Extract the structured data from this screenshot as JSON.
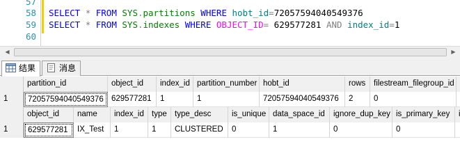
{
  "editor": {
    "lines": [
      {
        "num": "57",
        "tokens": []
      },
      {
        "num": "58",
        "tokens": [
          {
            "t": "SELECT",
            "c": "kw"
          },
          {
            "t": " ",
            "c": "pl"
          },
          {
            "t": "*",
            "c": "op"
          },
          {
            "t": " ",
            "c": "pl"
          },
          {
            "t": "FROM",
            "c": "kw"
          },
          {
            "t": " ",
            "c": "pl"
          },
          {
            "t": "SYS",
            "c": "sys"
          },
          {
            "t": ".",
            "c": "op"
          },
          {
            "t": "partitions",
            "c": "sys"
          },
          {
            "t": " ",
            "c": "pl"
          },
          {
            "t": "WHERE",
            "c": "kw"
          },
          {
            "t": " ",
            "c": "pl"
          },
          {
            "t": "hobt_id",
            "c": "id"
          },
          {
            "t": "=",
            "c": "op"
          },
          {
            "t": "72057594040549376",
            "c": "pl"
          }
        ]
      },
      {
        "num": "59",
        "tokens": [
          {
            "t": "SELECT",
            "c": "kw"
          },
          {
            "t": " ",
            "c": "pl"
          },
          {
            "t": "*",
            "c": "op"
          },
          {
            "t": " ",
            "c": "pl"
          },
          {
            "t": "FROM",
            "c": "kw"
          },
          {
            "t": " ",
            "c": "pl"
          },
          {
            "t": "SYS",
            "c": "sys"
          },
          {
            "t": ".",
            "c": "op"
          },
          {
            "t": "indexes",
            "c": "sys"
          },
          {
            "t": " ",
            "c": "pl"
          },
          {
            "t": "WHERE",
            "c": "kw"
          },
          {
            "t": " ",
            "c": "pl"
          },
          {
            "t": "OBJECT_ID",
            "c": "fn"
          },
          {
            "t": "=",
            "c": "op"
          },
          {
            "t": " 629577281 ",
            "c": "pl"
          },
          {
            "t": "AND",
            "c": "op"
          },
          {
            "t": " ",
            "c": "pl"
          },
          {
            "t": "index_id",
            "c": "id"
          },
          {
            "t": "=",
            "c": "op"
          },
          {
            "t": "1",
            "c": "pl"
          }
        ]
      },
      {
        "num": "60",
        "tokens": []
      }
    ]
  },
  "scrollbar": {
    "left_arrow": "◀",
    "right_arrow": "▶"
  },
  "tabs": [
    {
      "label": "结果",
      "icon": "grid-icon",
      "active": true
    },
    {
      "label": "消息",
      "icon": "message-icon",
      "active": false
    }
  ],
  "grid1": {
    "columns": [
      "",
      "partition_id",
      "object_id",
      "index_id",
      "partition_number",
      "hobt_id",
      "rows",
      "filestream_filegroup_id",
      "d"
    ],
    "rows": [
      [
        "1",
        "72057594040549376",
        "629577281",
        "1",
        "1",
        "72057594040549376",
        "2",
        "0",
        ""
      ]
    ]
  },
  "grid2": {
    "columns": [
      "",
      "object_id",
      "name",
      "index_id",
      "type",
      "type_desc",
      "is_unique",
      "data_space_id",
      "ignore_dup_key",
      "is_primary_key",
      "is"
    ],
    "rows": [
      [
        "1",
        "629577281",
        "IX_Test",
        "1",
        "1",
        "CLUSTERED",
        "0",
        "1",
        "0",
        "0",
        ""
      ]
    ]
  }
}
